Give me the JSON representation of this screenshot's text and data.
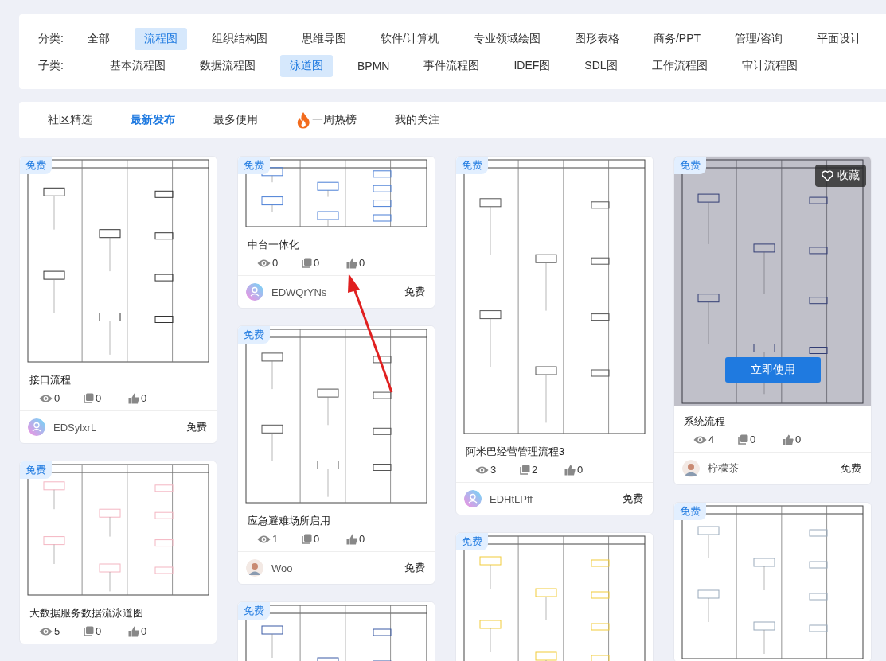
{
  "filters": [
    {
      "label": "分类:",
      "items": [
        {
          "text": "全部",
          "selected": false
        },
        {
          "text": "流程图",
          "selected": true
        },
        {
          "text": "组织结构图",
          "selected": false
        },
        {
          "text": "思维导图",
          "selected": false
        },
        {
          "text": "软件/计算机",
          "selected": false
        },
        {
          "text": "专业领域绘图",
          "selected": false
        },
        {
          "text": "图形表格",
          "selected": false
        },
        {
          "text": "商务/PPT",
          "selected": false
        },
        {
          "text": "管理/咨询",
          "selected": false
        },
        {
          "text": "平面设计",
          "selected": false
        }
      ]
    },
    {
      "label": "子类:",
      "items": [
        {
          "text": "基本流程图",
          "selected": false
        },
        {
          "text": "数据流程图",
          "selected": false
        },
        {
          "text": "泳道图",
          "selected": true
        },
        {
          "text": "BPMN",
          "selected": false
        },
        {
          "text": "事件流程图",
          "selected": false
        },
        {
          "text": "IDEF图",
          "selected": false
        },
        {
          "text": "SDL图",
          "selected": false
        },
        {
          "text": "工作流程图",
          "selected": false
        },
        {
          "text": "审计流程图",
          "selected": false
        }
      ]
    }
  ],
  "tabs": [
    {
      "label": "社区精选",
      "selected": false,
      "kind": "plain"
    },
    {
      "label": "最新发布",
      "selected": true,
      "kind": "plain"
    },
    {
      "label": "最多使用",
      "selected": false,
      "kind": "plain"
    },
    {
      "label": "一周热榜",
      "selected": false,
      "kind": "hot"
    },
    {
      "label": "我的关注",
      "selected": false,
      "kind": "plain"
    }
  ],
  "columns": [
    [
      {
        "badge": "免费",
        "title": "接口流程",
        "views": "0",
        "copies": "0",
        "likes": "0",
        "author": "EDSylxrL",
        "avatar": {
          "kind": "default"
        },
        "price": "免费"
      },
      {
        "badge": "免费",
        "title": "大数据服务数据流泳道图",
        "views": "5",
        "copies": "0",
        "likes": "0"
      }
    ],
    [
      {
        "badge": "免费",
        "title": "中台一体化",
        "views": "0",
        "copies": "0",
        "likes": "0",
        "author": "EDWQrYNs",
        "avatar": {
          "kind": "default"
        },
        "price": "免费"
      },
      {
        "badge": "免费",
        "title": "应急避难场所启用",
        "views": "1",
        "copies": "0",
        "likes": "0",
        "author": "Woo",
        "avatar": {
          "kind": "custom"
        },
        "price": "免费"
      },
      {
        "badge": "免费"
      }
    ],
    [
      {
        "badge": "免费",
        "title": "阿米巴经营管理流程3",
        "views": "3",
        "copies": "2",
        "likes": "0",
        "author": "EDHtLPff",
        "avatar": {
          "kind": "default"
        },
        "price": "免费"
      },
      {
        "badge": "免费"
      }
    ],
    [
      {
        "badge": "免费",
        "title": "系统流程",
        "views": "4",
        "copies": "0",
        "likes": "0",
        "author": "柠檬茶",
        "avatar": {
          "kind": "custom"
        },
        "price": "免费",
        "hover_actions": {
          "favorite": "收藏",
          "use": "立即使用"
        }
      },
      {
        "badge": "免费"
      }
    ]
  ]
}
